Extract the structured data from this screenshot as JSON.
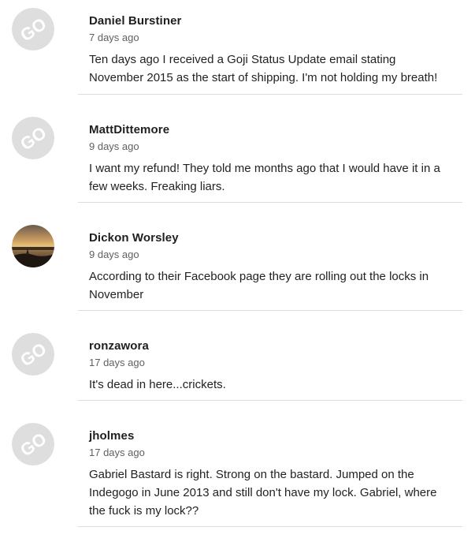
{
  "comments": [
    {
      "author": "Daniel Burstiner",
      "time": "7 days ago",
      "text": "Ten days ago I received a Goji Status Update email stating November 2015 as the start of shipping. I'm not holding my breath!",
      "avatar": "go-default-avatar"
    },
    {
      "author": "MattDittemore",
      "time": "9 days ago",
      "text": "I want my refund! They told me months ago that I would have it in a few weeks. Freaking liars.",
      "avatar": "go-default-avatar"
    },
    {
      "author": "Dickon Worsley",
      "time": "9 days ago",
      "text": "According to their Facebook page they are rolling out the locks in November",
      "avatar": "sunset-photo-avatar"
    },
    {
      "author": "ronzawora",
      "time": "17 days ago",
      "text": "It's dead in here...crickets.",
      "avatar": "go-default-avatar"
    },
    {
      "author": "jholmes",
      "time": "17 days ago",
      "text": "Gabriel Bastard is right. Strong on the bastard. Jumped on the Indegogo in June 2013 and still don't have my lock. Gabriel, where the fuck is my lock??",
      "avatar": "go-default-avatar"
    }
  ],
  "avatar_logo_text": "GO",
  "colors": {
    "avatar_bg": "#dedede",
    "avatar_logo": "#ffffff",
    "divider": "#dcdcdc",
    "author": "#1f1f1f",
    "time": "#606060"
  }
}
